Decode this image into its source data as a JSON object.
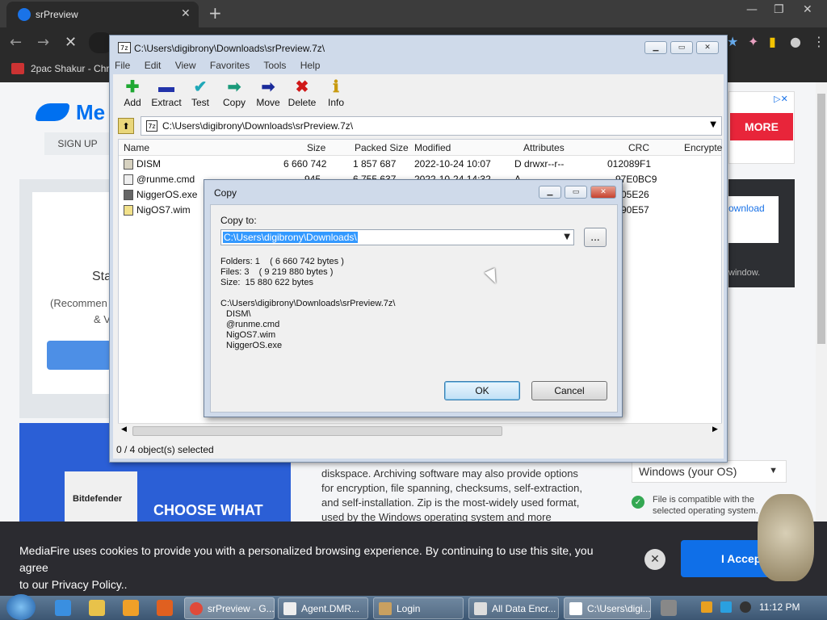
{
  "browser": {
    "tab_title": "srPreview",
    "bookmark": "2pac Shakur - Chro"
  },
  "site": {
    "logo_text": "Me",
    "signup": "SIGN UP",
    "card_heading": "Sta",
    "card_sub": "(Recommen",
    "card_sub2": "& V",
    "promo_brand": "Bitdefender",
    "promo_text": "CHOOSE WHAT",
    "ad_text": "MORE",
    "download_link": "ownload",
    "download_note": "window.",
    "article_lines": [
      "diskspace. Archiving software may also provide options",
      "for encryption, file spanning, checksums, self-extraction,",
      "and self-installation. Zip is the most-widely used format,",
      "used by the Windows operating system and more"
    ],
    "os_select": "Windows (your OS)",
    "compat_line1": "File is compatible with the",
    "compat_line2": "selected operating system."
  },
  "cookie": {
    "text1": "MediaFire uses cookies to provide you with a personalized browsing experience. By continuing to use this site, you agree",
    "text2": "to our Privacy Policy..",
    "accept": "I Accept"
  },
  "sevenzip": {
    "title": "C:\\Users\\digibrony\\Downloads\\srPreview.7z\\",
    "menu": [
      "File",
      "Edit",
      "View",
      "Favorites",
      "Tools",
      "Help"
    ],
    "toolbar": [
      {
        "label": "Add",
        "glyph": "✚",
        "color": "#1ea832"
      },
      {
        "label": "Extract",
        "glyph": "▬",
        "color": "#2233aa"
      },
      {
        "label": "Test",
        "glyph": "✔",
        "color": "#20a8b8"
      },
      {
        "label": "Copy",
        "glyph": "➡",
        "color": "#1a9a7a"
      },
      {
        "label": "Move",
        "glyph": "➡",
        "color": "#1a2a9a"
      },
      {
        "label": "Delete",
        "glyph": "✖",
        "color": "#d01818"
      },
      {
        "label": "Info",
        "glyph": "ℹ",
        "color": "#c89a10"
      }
    ],
    "address": "C:\\Users\\digibrony\\Downloads\\srPreview.7z\\",
    "columns": {
      "name": "Name",
      "size": "Size",
      "packed": "Packed Size",
      "modified": "Modified",
      "attributes": "Attributes",
      "crc": "CRC",
      "encrypted": "Encrypte"
    },
    "files": [
      {
        "name": "DISM",
        "size": "6 660 742",
        "packed": "1 857 687",
        "modified": "2022-10-24 10:07",
        "attributes": "D drwxr--r--",
        "crc": "012089F1"
      },
      {
        "name": "@runme.cmd",
        "size": "945",
        "packed": "6 755 637",
        "modified": "2022-10-24 14:32",
        "attributes": "A",
        "crc": "97E0BC9"
      },
      {
        "name": "NiggerOS.exe",
        "size": "",
        "packed": "",
        "modified": "",
        "attributes": "",
        "crc": "05E26"
      },
      {
        "name": "NigOS7.wim",
        "size": "",
        "packed": "",
        "modified": "",
        "attributes": "",
        "crc": "90E57"
      }
    ],
    "status": "0 / 4 object(s) selected"
  },
  "copy_dialog": {
    "title": "Copy",
    "copy_to_label": "Copy to:",
    "path_value": "C:\\Users\\digibrony\\Downloads\\",
    "browse": "...",
    "stats": "Folders: 1    ( 6 660 742 bytes )\nFiles: 3    ( 9 219 880 bytes )\nSize:  15 880 622 bytes",
    "source": "C:\\Users\\digibrony\\Downloads\\srPreview.7z\\",
    "items": [
      "DISM\\",
      "@runme.cmd",
      "NigOS7.wim",
      "NiggerOS.exe"
    ],
    "ok": "OK",
    "cancel": "Cancel"
  },
  "taskbar": {
    "buttons": [
      "srPreview - G...",
      "Agent.DMR...",
      "Login",
      "All Data Encr...",
      "C:\\Users\\digi..."
    ],
    "clock": "11:12 PM"
  }
}
